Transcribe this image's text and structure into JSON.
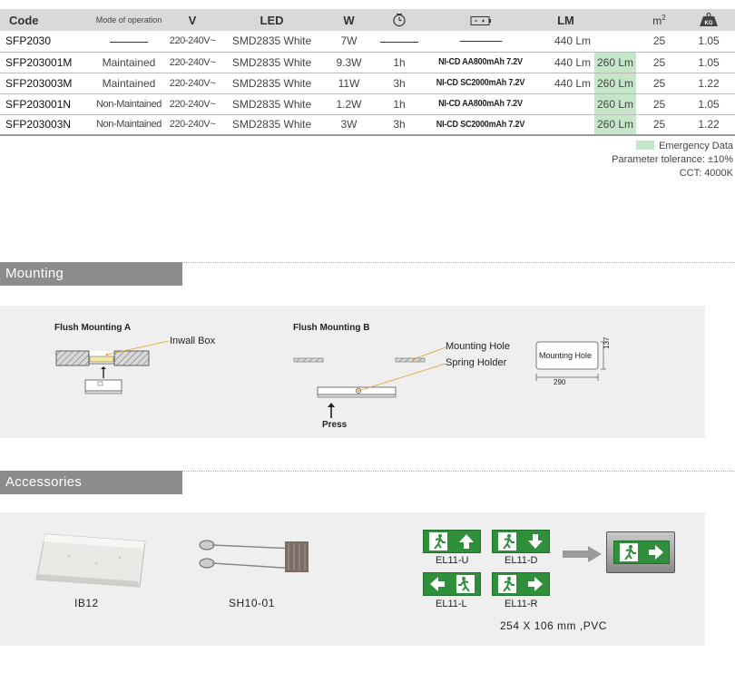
{
  "table": {
    "headers": {
      "code": "Code",
      "mode": "Mode of operation",
      "voltage": "V",
      "led": "LED",
      "watt": "W",
      "lm": "LM",
      "area": "m",
      "area_sup": "2",
      "weight_icon": "KG"
    },
    "rows": [
      {
        "code": "SFP2030",
        "mode": "",
        "voltage": "220-240V~",
        "led": "SMD2835 White",
        "watt": "7W",
        "duration": "",
        "battery": "",
        "lm": "440 Lm",
        "em_lm": "",
        "area": "25",
        "weight": "1.05"
      },
      {
        "code": "SFP203001M",
        "mode": "Maintained",
        "voltage": "220-240V~",
        "led": "SMD2835 White",
        "watt": "9.3W",
        "duration": "1h",
        "battery": "NI-CD AA800mAh 7.2V",
        "lm": "440 Lm",
        "em_lm": "260 Lm",
        "area": "25",
        "weight": "1.05"
      },
      {
        "code": "SFP203003M",
        "mode": "Maintained",
        "voltage": "220-240V~",
        "led": "SMD2835 White",
        "watt": "11W",
        "duration": "3h",
        "battery": "NI-CD SC2000mAh 7.2V",
        "lm": "440 Lm",
        "em_lm": "260 Lm",
        "area": "25",
        "weight": "1.22"
      },
      {
        "code": "SFP203001N",
        "mode": "Non-Maintained",
        "voltage": "220-240V~",
        "led": "SMD2835 White",
        "watt": "1.2W",
        "duration": "1h",
        "battery": "NI-CD AA800mAh 7.2V",
        "lm": "",
        "em_lm": "260 Lm",
        "area": "25",
        "weight": "1.05"
      },
      {
        "code": "SFP203003N",
        "mode": "Non-Maintained",
        "voltage": "220-240V~",
        "led": "SMD2835 White",
        "watt": "3W",
        "duration": "3h",
        "battery": "NI-CD SC2000mAh 7.2V",
        "lm": "",
        "em_lm": "260 Lm",
        "area": "25",
        "weight": "1.22"
      }
    ]
  },
  "notes": {
    "legend": "Emergency Data",
    "tolerance": "Parameter tolerance: ±10%",
    "cct": "CCT: 4000K"
  },
  "colors": {
    "emergency": "#c6e6c9",
    "header_bg": "#d9d9d9",
    "section_bg": "#8c8c8c",
    "sign_green": "#2f8f3b"
  },
  "mounting": {
    "title": "Mounting",
    "flush_a": "Flush Mounting A",
    "inwall_box": "Inwall Box",
    "flush_b": "Flush Mounting B",
    "mounting_hole": "Mounting Hole",
    "spring_holder": "Spring Holder",
    "press": "Press",
    "hole_box_label": "Mounting Hole",
    "hole_width": "290",
    "hole_height": "137"
  },
  "accessories": {
    "title": "Accessories",
    "ib12": "IB12",
    "sh10": "SH10-01",
    "signs": [
      "EL11-U",
      "EL11-D",
      "EL11-L",
      "EL11-R"
    ],
    "sign_spec": "254 X 106 mm ,PVC"
  }
}
